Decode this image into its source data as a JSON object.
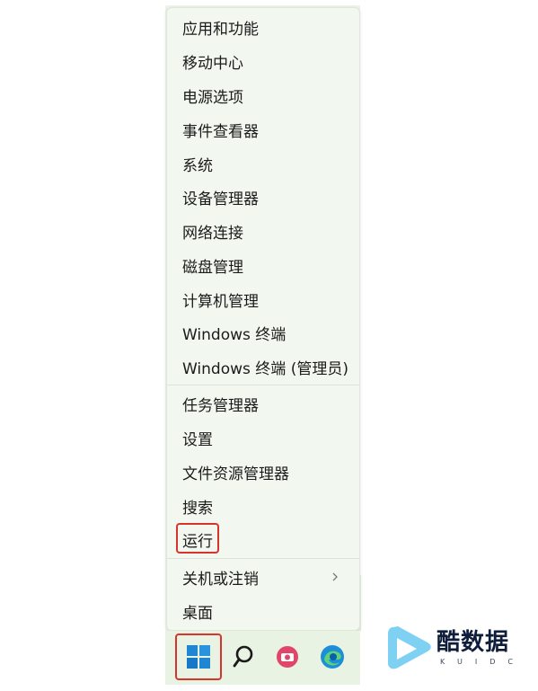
{
  "menu": {
    "items": [
      {
        "label": "应用和功能"
      },
      {
        "label": "移动中心"
      },
      {
        "label": "电源选项"
      },
      {
        "label": "事件查看器"
      },
      {
        "label": "系统"
      },
      {
        "label": "设备管理器"
      },
      {
        "label": "网络连接"
      },
      {
        "label": "磁盘管理"
      },
      {
        "label": "计算机管理"
      },
      {
        "label": "Windows 终端"
      },
      {
        "label": "Windows 终端 (管理员)"
      },
      {
        "label": "任务管理器"
      },
      {
        "label": "设置"
      },
      {
        "label": "文件资源管理器"
      },
      {
        "label": "搜索"
      },
      {
        "label": "运行",
        "highlighted": true
      },
      {
        "label": "关机或注销",
        "has_submenu": true
      },
      {
        "label": "桌面"
      }
    ]
  },
  "taskbar": {
    "buttons": [
      {
        "icon": "windows-start-icon",
        "highlighted": true
      },
      {
        "icon": "search-icon"
      },
      {
        "icon": "camera-app-icon"
      },
      {
        "icon": "edge-browser-icon"
      }
    ]
  },
  "watermark": {
    "name": "酷数据",
    "sub": "KUIDC"
  },
  "colors": {
    "highlight_border": "#d8342b",
    "menu_bg": "#f2f8ef",
    "taskbar_bg": "#e9f3e3"
  }
}
